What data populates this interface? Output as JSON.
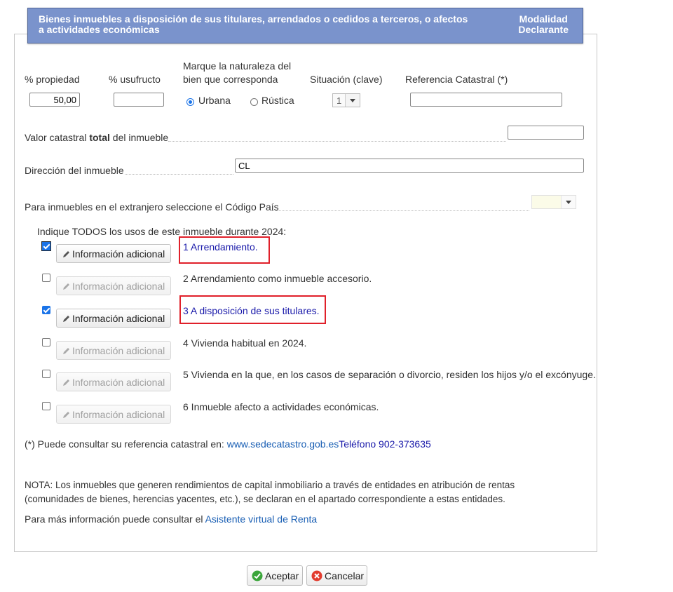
{
  "header": {
    "title": "Bienes inmuebles a disposición de sus titulares, arrendados o cedidos a terceros, o afectos a actividades económicas",
    "mode_line1": "Modalidad",
    "mode_line2": "Declarante"
  },
  "ownership": {
    "propiedad_label": "% propiedad",
    "propiedad_value": "50,00",
    "usufructo_label": "% usufructo",
    "usufructo_value": "",
    "naturaleza_line1": "Marque la naturaleza del",
    "naturaleza_line2": "bien que corresponda",
    "urbana_label": "Urbana",
    "rustica_label": "Rústica",
    "selected_nature": "Urbana",
    "situacion_label": "Situación (clave)",
    "situacion_value": "1",
    "referencia_label": "Referencia Catastral (*)",
    "referencia_value": ""
  },
  "valor": {
    "label_pre": "Valor catastral ",
    "label_bold": "total",
    "label_post": " del inmueble",
    "value": ""
  },
  "direccion": {
    "label": "Dirección del inmueble",
    "value": "CL"
  },
  "extranjero": {
    "label": "Para inmuebles en el extranjero seleccione el Código País",
    "value": ""
  },
  "usos": {
    "heading": "Indique TODOS los usos de este inmueble durante 2024:",
    "button_label": "Información adicional",
    "items": [
      {
        "label": "1 Arrendamiento.",
        "checked": true
      },
      {
        "label": "2 Arrendamiento como inmueble accesorio.",
        "checked": false
      },
      {
        "label": "3 A disposición de sus titulares.",
        "checked": true
      },
      {
        "label": "4 Vivienda habitual en 2024.",
        "checked": false
      },
      {
        "label": "5 Vivienda en la que, en los casos de separación o divorcio, residen los hijos y/o el excónyuge.",
        "checked": false
      },
      {
        "label": "6 Inmueble afecto a actividades económicas.",
        "checked": false
      }
    ]
  },
  "catastro": {
    "text": "(*) Puede consultar su referencia catastral en: ",
    "link": "www.sedecatastro.gob.es",
    "phone": "Teléfono 902-373635"
  },
  "nota": {
    "line1": "NOTA: Los inmuebles que generen rendimientos de capital inmobiliario a través de entidades en atribución de rentas",
    "line2": "(comunidades de bienes, herencias yacentes, etc.), se declaran en el apartado correspondiente a estas entidades."
  },
  "asistente": {
    "text": "Para más información puede consultar el ",
    "link": "Asistente virtual de Renta"
  },
  "actions": {
    "accept_label": "Aceptar",
    "cancel_label": "Cancelar"
  },
  "colors": {
    "header_bg": "#7a93cc",
    "link": "#1a5fb4",
    "active_use": "#1a1aaa",
    "highlight_box": "#e0202a"
  }
}
